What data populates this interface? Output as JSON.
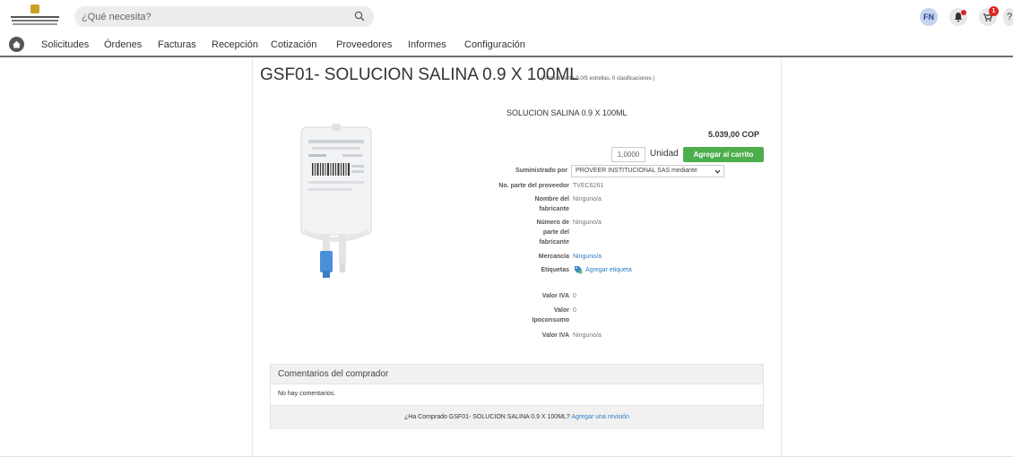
{
  "search": {
    "placeholder": "¿Qué necesita?"
  },
  "user": {
    "initials": "FN"
  },
  "header": {
    "cart_count": "1",
    "help_label": "?"
  },
  "nav": {
    "items": [
      "Solicitudes",
      "Órdenes",
      "Facturas",
      "Recepción",
      "Cotización",
      "Proveedores",
      "Informes",
      "Configuración"
    ]
  },
  "product": {
    "title": "GSF01- SOLUCION SALINA 0.9 X 100ML",
    "rating_text": "( Actualmente 0.0/5 estrellas. 0 clasificaciones )",
    "subtitle": "SOLUCION SALINA 0.9 X 100ML",
    "price": "5.039,00 COP",
    "quantity": "1,0000",
    "unit": "Unidad",
    "add_to_cart": "Agregar al carrito"
  },
  "details": {
    "supplied_by_label": "Suministrado por",
    "supplied_by_value": "PROVEER INSTITUCIONAL SAS mediante",
    "supplier_part_label": "No. parte del proveedor",
    "supplier_part_value": "TVEC6261",
    "manufacturer_label": "Nombre del fabricante",
    "manufacturer_value": "Ninguno/a",
    "manufacturer_part_label": "Número de parte del fabricante",
    "manufacturer_part_value": "Ninguno/a",
    "merchandise_label": "Mercancía",
    "merchandise_value": "Ninguno/a",
    "tags_label": "Etiquetas",
    "tags_value": "Agregar etiqueta",
    "iva_label": "Valor IVA",
    "iva_value": "0",
    "ipoconsumo_label": "Valor Ipoconsumo",
    "ipoconsumo_value": "0",
    "iva2_label": "Valor IVA",
    "iva2_value": "Ninguno/a"
  },
  "comments": {
    "header": "Comentarios del comprador",
    "empty": "No hay comentarios.",
    "prompt": "¿Ha Comprado GSF01- SOLUCION SALINA 0.9 X 100ML?",
    "review_link": "Agregar una revisión"
  },
  "colors": {
    "accent_green": "#4cae4c",
    "link_blue": "#2e7bc6",
    "badge_red": "#e02424"
  }
}
